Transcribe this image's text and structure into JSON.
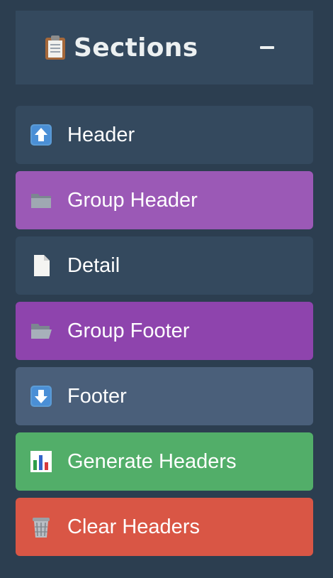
{
  "panel": {
    "title": "Sections",
    "title_icon": "clipboard-icon",
    "collapse_icon": "minus-icon"
  },
  "sections": [
    {
      "id": "header",
      "label": "Header",
      "icon": "up-arrow-icon",
      "color": "#34495e"
    },
    {
      "id": "group-header",
      "label": "Group Header",
      "icon": "folder-icon",
      "color": "#9b59b6"
    },
    {
      "id": "detail",
      "label": "Detail",
      "icon": "document-icon",
      "color": "#34495e"
    },
    {
      "id": "group-footer",
      "label": "Group Footer",
      "icon": "open-folder-icon",
      "color": "#8e44ad"
    },
    {
      "id": "footer",
      "label": "Footer",
      "icon": "down-arrow-icon",
      "color": "#4a5f7a"
    }
  ],
  "actions": [
    {
      "id": "generate-headers",
      "label": "Generate Headers",
      "icon": "bar-chart-icon",
      "color": "#52ae69"
    },
    {
      "id": "clear-headers",
      "label": "Clear Headers",
      "icon": "wastebasket-icon",
      "color": "#d95645"
    }
  ]
}
